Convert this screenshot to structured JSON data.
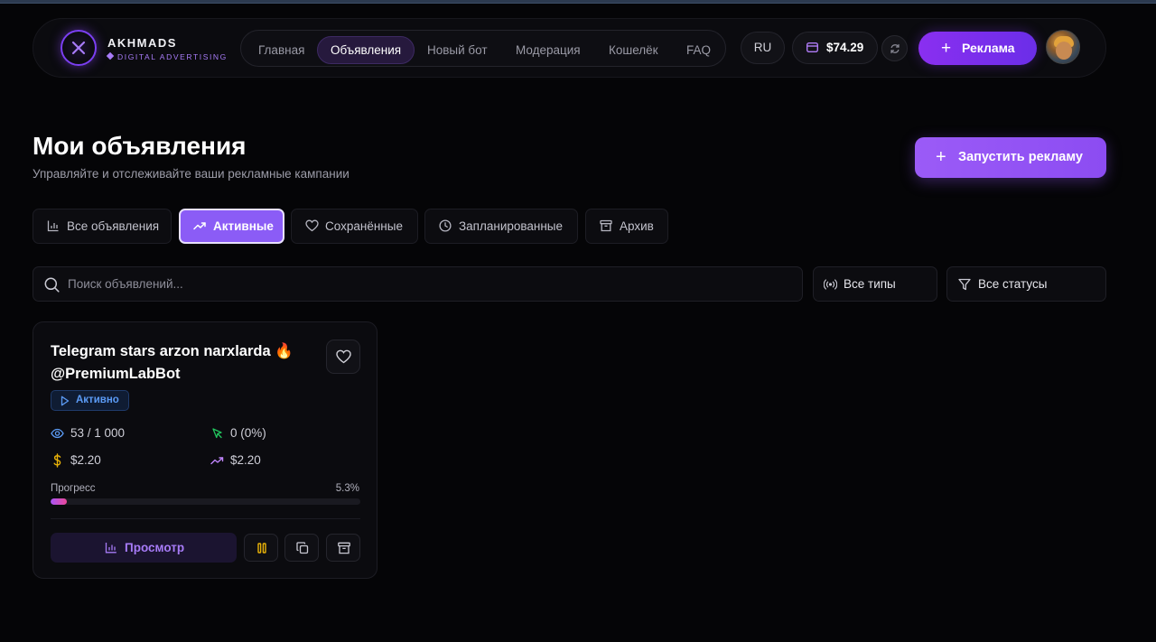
{
  "brand": {
    "name": "AKHMADS",
    "tagline": "DIGITAL ADVERTISING",
    "accent": "#8b5cf6"
  },
  "nav": {
    "items": [
      {
        "label": "Главная",
        "active": false
      },
      {
        "label": "Объявления",
        "active": true
      },
      {
        "label": "Новый бот",
        "active": false
      },
      {
        "label": "Модерация",
        "active": false
      },
      {
        "label": "Кошелёк",
        "active": false
      },
      {
        "label": "FAQ",
        "active": false
      }
    ],
    "language": "RU",
    "balance": "$74.29",
    "ads_button": "Реклама"
  },
  "header": {
    "title": "Мои объявления",
    "subtitle": "Управляйте и отслеживайте ваши рекламные кампании",
    "launch_button": "Запустить рекламу"
  },
  "tabs": [
    {
      "label": "Все объявления",
      "icon": "bar-chart-icon",
      "active": false
    },
    {
      "label": "Активные",
      "icon": "trending-up-icon",
      "active": true
    },
    {
      "label": "Сохранённые",
      "icon": "heart-icon",
      "active": false
    },
    {
      "label": "Запланированные",
      "icon": "clock-icon",
      "active": false
    },
    {
      "label": "Архив",
      "icon": "archive-icon",
      "active": false
    }
  ],
  "filters": {
    "search_placeholder": "Поиск объявлений...",
    "type_select": "Все типы",
    "status_select": "Все статусы"
  },
  "ad_card": {
    "title": "Telegram stars arzon narxlarda 🔥 @PremiumLabBot",
    "status": "Активно",
    "views": "53 / 1 000",
    "clicks": "0 (0%)",
    "budget": "$2.20",
    "spent": "$2.20",
    "progress_label": "Прогресс",
    "progress_text": "5.3%",
    "progress_value": 0.053,
    "view_button": "Просмотр"
  }
}
